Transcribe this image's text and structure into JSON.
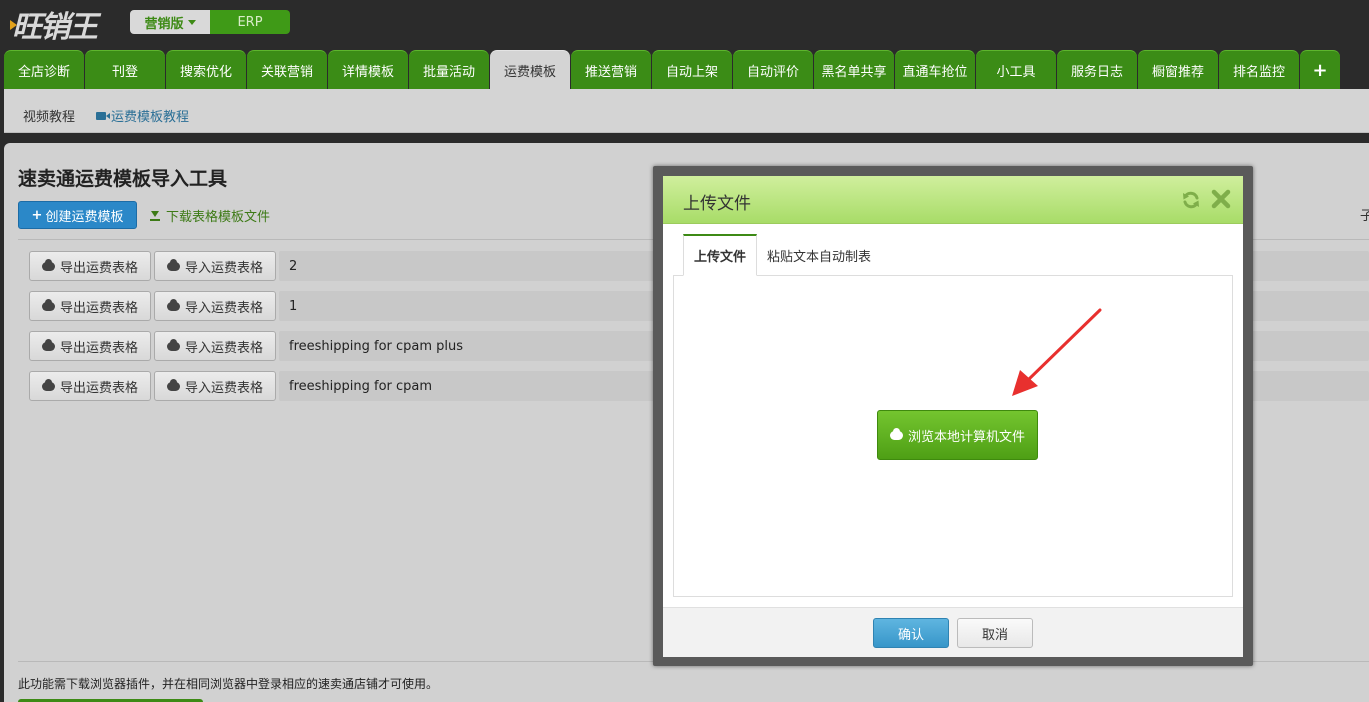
{
  "header": {
    "logo_text": "旺销王",
    "edition_active": "营销版",
    "edition_other": "ERP"
  },
  "nav": {
    "tabs": [
      {
        "label": "全店诊断"
      },
      {
        "label": "刊登"
      },
      {
        "label": "搜索优化"
      },
      {
        "label": "关联营销"
      },
      {
        "label": "详情模板"
      },
      {
        "label": "批量活动"
      },
      {
        "label": "运费模板"
      },
      {
        "label": "推送营销"
      },
      {
        "label": "自动上架"
      },
      {
        "label": "自动评价"
      },
      {
        "label": "黑名单共享"
      },
      {
        "label": "直通车抢位"
      },
      {
        "label": "小工具"
      },
      {
        "label": "服务日志"
      },
      {
        "label": "橱窗推荐"
      },
      {
        "label": "排名监控"
      },
      {
        "label": "+"
      }
    ],
    "active_index": 6
  },
  "subnav": {
    "video_tutorial": "视频教程",
    "template_tutorial": "运费模板教程"
  },
  "page": {
    "title": "速卖通运费模板导入工具",
    "create_button": "创建运费模板",
    "download_link": "下载表格模板文件",
    "right_edge_text": "子",
    "rows": [
      {
        "export_label": "导出运费表格",
        "import_label": "导入运费表格",
        "name": "2"
      },
      {
        "export_label": "导出运费表格",
        "import_label": "导入运费表格",
        "name": "1"
      },
      {
        "export_label": "导出运费表格",
        "import_label": "导入运费表格",
        "name": "freeshipping for cpam plus"
      },
      {
        "export_label": "导出运费表格",
        "import_label": "导入运费表格",
        "name": "freeshipping for cpam"
      }
    ],
    "footer_note": "此功能需下载浏览器插件，并在相同浏览器中登录相应的速卖通店铺才可使用。"
  },
  "modal": {
    "title": "上传文件",
    "tabs": [
      {
        "label": "上传文件"
      },
      {
        "label": "粘贴文本自动制表"
      }
    ],
    "browse_button": "浏览本地计算机文件",
    "ok_button": "确认",
    "cancel_button": "取消"
  },
  "colors": {
    "nav_green": "#3b8c16",
    "primary_blue": "#2b88c8",
    "modal_header": "#a8dc68",
    "arrow_red": "#e8302e"
  }
}
